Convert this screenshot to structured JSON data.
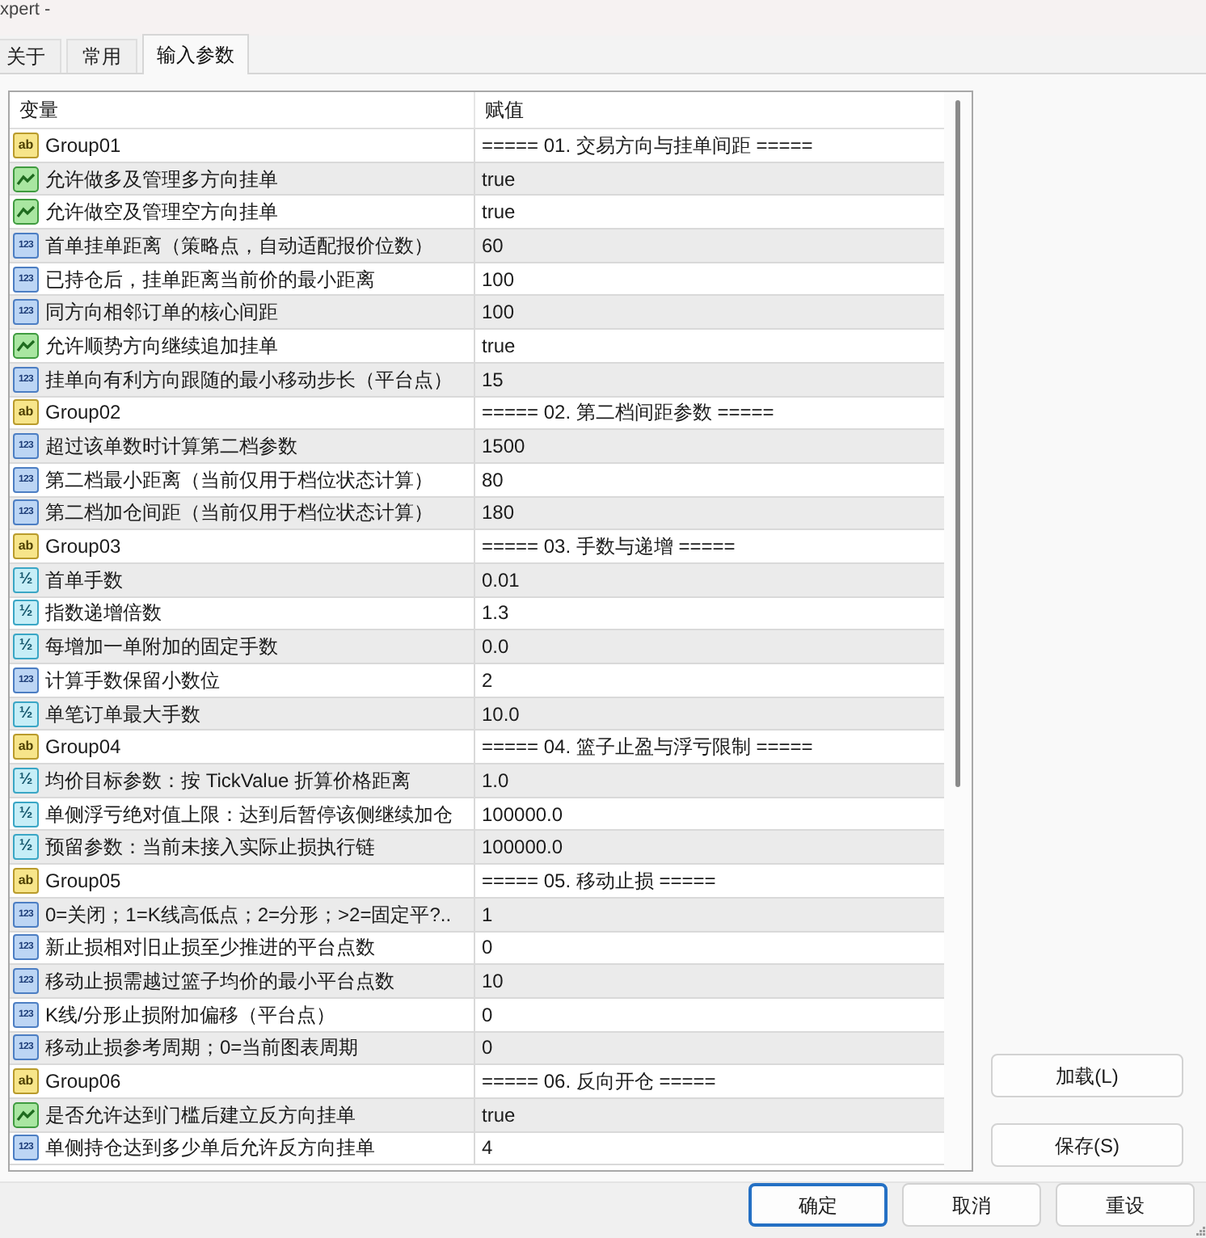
{
  "window": {
    "title": "xpert -"
  },
  "tabs": [
    {
      "label": "关于",
      "selected": false
    },
    {
      "label": "常用",
      "selected": false
    },
    {
      "label": "输入参数",
      "selected": true
    }
  ],
  "table": {
    "columns": [
      "变量",
      "赋值"
    ],
    "rows": [
      {
        "kind": "string",
        "icon_text": "ab",
        "name": "Group01",
        "value": "===== 01. 交易方向与挂单间距 ====="
      },
      {
        "kind": "bool",
        "name": "允许做多及管理多方向挂单",
        "value": "true"
      },
      {
        "kind": "bool",
        "name": "允许做空及管理空方向挂单",
        "value": "true"
      },
      {
        "kind": "int",
        "icon_text": "123",
        "name": "首单挂单距离（策略点，自动适配报价位数）",
        "value": "60"
      },
      {
        "kind": "int",
        "icon_text": "123",
        "name": "已持仓后，挂单距离当前价的最小距离",
        "value": "100"
      },
      {
        "kind": "int",
        "icon_text": "123",
        "name": "同方向相邻订单的核心间距",
        "value": "100"
      },
      {
        "kind": "bool",
        "name": "允许顺势方向继续追加挂单",
        "value": "true"
      },
      {
        "kind": "int",
        "icon_text": "123",
        "name": "挂单向有利方向跟随的最小移动步长（平台点）",
        "value": "15"
      },
      {
        "kind": "string",
        "icon_text": "ab",
        "name": "Group02",
        "value": "===== 02. 第二档间距参数 ====="
      },
      {
        "kind": "int",
        "icon_text": "123",
        "name": "超过该单数时计算第二档参数",
        "value": "1500"
      },
      {
        "kind": "int",
        "icon_text": "123",
        "name": "第二档最小距离（当前仅用于档位状态计算）",
        "value": "80"
      },
      {
        "kind": "int",
        "icon_text": "123",
        "name": "第二档加仓间距（当前仅用于档位状态计算）",
        "value": "180"
      },
      {
        "kind": "string",
        "icon_text": "ab",
        "name": "Group03",
        "value": "===== 03. 手数与递增 ====="
      },
      {
        "kind": "double",
        "icon_text": "½",
        "name": "首单手数",
        "value": "0.01"
      },
      {
        "kind": "double",
        "icon_text": "½",
        "name": "指数递增倍数",
        "value": "1.3"
      },
      {
        "kind": "double",
        "icon_text": "½",
        "name": "每增加一单附加的固定手数",
        "value": "0.0"
      },
      {
        "kind": "int",
        "icon_text": "123",
        "name": "计算手数保留小数位",
        "value": "2"
      },
      {
        "kind": "double",
        "icon_text": "½",
        "name": "单笔订单最大手数",
        "value": "10.0"
      },
      {
        "kind": "string",
        "icon_text": "ab",
        "name": "Group04",
        "value": "===== 04. 篮子止盈与浮亏限制 ====="
      },
      {
        "kind": "double",
        "icon_text": "½",
        "name": "均价目标参数：按 TickValue 折算价格距离",
        "value": "1.0"
      },
      {
        "kind": "double",
        "icon_text": "½",
        "name": "单侧浮亏绝对值上限：达到后暂停该侧继续加仓",
        "value": "100000.0"
      },
      {
        "kind": "double",
        "icon_text": "½",
        "name": "预留参数：当前未接入实际止损执行链",
        "value": "100000.0"
      },
      {
        "kind": "string",
        "icon_text": "ab",
        "name": "Group05",
        "value": "===== 05. 移动止损 ====="
      },
      {
        "kind": "int",
        "icon_text": "123",
        "name": "0=关闭；1=K线高低点；2=分形；>2=固定平?..",
        "value": "1"
      },
      {
        "kind": "int",
        "icon_text": "123",
        "name": "新止损相对旧止损至少推进的平台点数",
        "value": "0"
      },
      {
        "kind": "int",
        "icon_text": "123",
        "name": "移动止损需越过篮子均价的最小平台点数",
        "value": "10"
      },
      {
        "kind": "int",
        "icon_text": "123",
        "name": "K线/分形止损附加偏移（平台点）",
        "value": "0"
      },
      {
        "kind": "int",
        "icon_text": "123",
        "name": "移动止损参考周期；0=当前图表周期",
        "value": "0"
      },
      {
        "kind": "string",
        "icon_text": "ab",
        "name": "Group06",
        "value": "===== 06. 反向开仓 ====="
      },
      {
        "kind": "bool",
        "name": "是否允许达到门槛后建立反方向挂单",
        "value": "true"
      },
      {
        "kind": "int",
        "icon_text": "123",
        "name": "单侧持仓达到多少单后允许反方向挂单",
        "value": "4"
      }
    ]
  },
  "side_buttons": [
    "加载(L)",
    "保存(S)"
  ],
  "buttons": [
    {
      "label": "确定",
      "focused": true
    },
    {
      "label": "取消",
      "focused": false
    },
    {
      "label": "重设",
      "focused": false
    }
  ]
}
